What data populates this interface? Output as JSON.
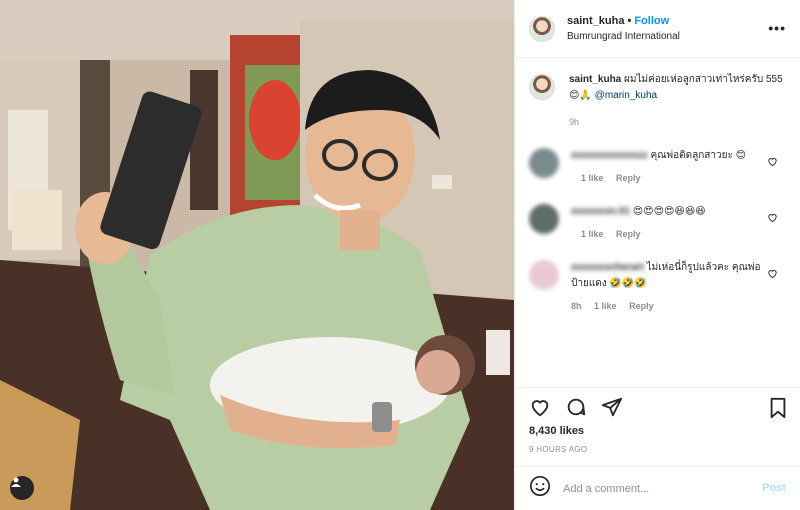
{
  "post": {
    "username": "saint_kuha",
    "follow_label": "Follow",
    "location": "Bumrungrad International",
    "more_icon": "more-horizontal-icon"
  },
  "caption": {
    "username": "saint_kuha",
    "text": "ผมไม่ค่อยเห่อลูกสาวเท่าไหร่ครับ 555 😊🙏",
    "mention": "@marin_kuha",
    "time": "9h"
  },
  "comments": [
    {
      "username": "xxxxxxxxxxxxzz",
      "text": "คุณพ่อติดลูกสาวยะ 😊",
      "meta": [
        "",
        "1 like",
        "Reply"
      ],
      "avatar_color": "#7b8a8e"
    },
    {
      "username": "xxxxxxxn.51",
      "text": "😍😍😍😍😆😆😆",
      "meta": [
        "",
        "1 like",
        "Reply"
      ],
      "avatar_color": "#5f6d6a"
    },
    {
      "username": "xxxxxxxcherart",
      "text": "ไม่เห่อนี่ก็รูปแล้วคะ คุณพ่อป้ายแดง 🤣🤣🤣",
      "meta": [
        "8h",
        "1 like",
        "Reply"
      ],
      "avatar_color": "#e9c9d6"
    }
  ],
  "actions": {
    "like_icon": "heart-icon",
    "comment_icon": "comment-icon",
    "share_icon": "share-icon",
    "save_icon": "bookmark-icon"
  },
  "likes": "8,430 likes",
  "age": "9 HOURS AGO",
  "composer": {
    "placeholder": "Add a comment...",
    "post_label": "Post",
    "emoji_icon": "emoji-icon"
  },
  "colors": {
    "link": "#0095f6",
    "post_disabled": "#b2dffc",
    "muted": "#8e8e8e"
  }
}
